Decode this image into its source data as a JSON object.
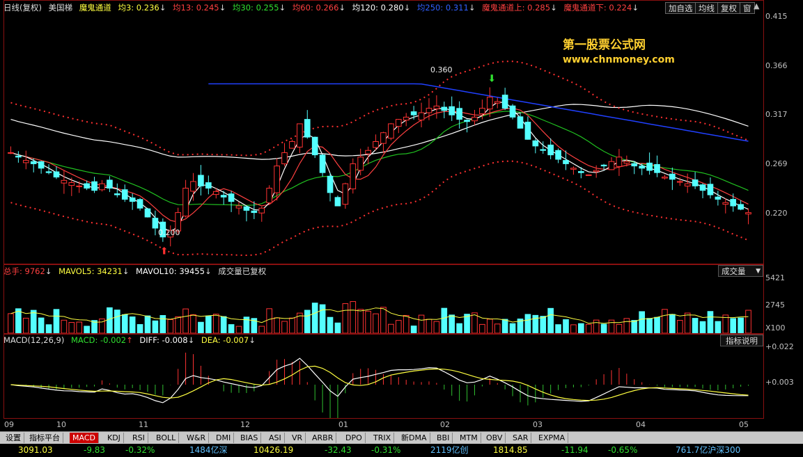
{
  "header": {
    "period": "日线(复权)",
    "stock": "美国梯",
    "indicator": "魔鬼通道",
    "ma3": "均3: 0.236",
    "ma13": "均13: 0.245",
    "ma30": "均30: 0.255",
    "ma60": "均60: 0.266",
    "ma120": "均120: 0.280",
    "ma250": "均250: 0.311",
    "upper": "魔鬼通道上: 0.285",
    "lower": "魔鬼通道下: 0.224",
    "buttons": [
      "加自选",
      "均线",
      "复权",
      "窗"
    ]
  },
  "watermark": {
    "title": "第一股票公式网",
    "url": "www.chnmoney.com"
  },
  "price_axis": [
    "0.415",
    "0.366",
    "0.317",
    "0.269",
    "0.220"
  ],
  "annotations": {
    "high": "0.360",
    "low": "0.200"
  },
  "volume_header": {
    "label": "总手: 9762",
    "mavol5": "MAVOL5: 34231",
    "mavol10": "MAVOL10: 39455",
    "note": "成交量已复权",
    "select": "成交量"
  },
  "volume_axis": [
    "5421",
    "2745",
    "X100"
  ],
  "macd_header": {
    "label": "MACD(12,26,9)",
    "macd": "MACD: -0.002",
    "diff": "DIFF: -0.008",
    "dea": "DEA: -0.007",
    "button": "指标说明"
  },
  "macd_axis": [
    "+0.022",
    "+0.003"
  ],
  "x_axis": [
    "09",
    "10",
    "11",
    "12",
    "01",
    "02",
    "03",
    "04",
    "05"
  ],
  "tabs": [
    "设置",
    "指标平台",
    "MACD",
    "KDJ",
    "RSI",
    "BOLL",
    "W&R",
    "DMI",
    "BIAS",
    "ASI",
    "VR",
    "ARBR",
    "DPO",
    "TRIX",
    "新DMA",
    "BBI",
    "MTM",
    "OBV",
    "SAR",
    "EXPMA"
  ],
  "status": {
    "sh_index": "3091.03",
    "sh_change": "-9.83",
    "sh_pct": "-0.32%",
    "sh_amount": "1484亿深",
    "sz_index": "10426.19",
    "sz_change": "-32.43",
    "sz_pct": "-0.31%",
    "cy_amount": "2119亿创",
    "cy_index": "1814.85",
    "cy_change": "-11.94",
    "cy_pct": "-0.65%",
    "hs_amount": "761.7亿沪深300"
  },
  "colors": {
    "up": "#ff3232",
    "down": "#54ffff",
    "ma3": "#ffffff",
    "ma13": "#ff4040",
    "ma30": "#20c020",
    "ma120": "#ffffff",
    "ma250": "#2040ff",
    "channel": "#ff3030",
    "accent": "#ffff00"
  },
  "chart_data": {
    "type": "candlestick",
    "title": "",
    "x_month_labels": [
      "09",
      "10",
      "11",
      "12",
      "01",
      "02",
      "03",
      "04",
      "05"
    ],
    "ylim": [
      0.19,
      0.415
    ],
    "price_ticks": [
      0.415,
      0.366,
      0.317,
      0.269,
      0.22
    ],
    "high": 0.36,
    "low": 0.2,
    "closes": [
      0.29,
      0.286,
      0.283,
      0.28,
      0.276,
      0.272,
      0.268,
      0.265,
      0.263,
      0.26,
      0.258,
      0.256,
      0.262,
      0.258,
      0.252,
      0.248,
      0.246,
      0.24,
      0.232,
      0.222,
      0.214,
      0.22,
      0.236,
      0.258,
      0.264,
      0.26,
      0.258,
      0.255,
      0.25,
      0.246,
      0.242,
      0.238,
      0.236,
      0.24,
      0.258,
      0.278,
      0.29,
      0.3,
      0.316,
      0.304,
      0.288,
      0.272,
      0.254,
      0.242,
      0.262,
      0.28,
      0.286,
      0.292,
      0.3,
      0.308,
      0.316,
      0.32,
      0.322,
      0.324,
      0.326,
      0.33,
      0.332,
      0.328,
      0.324,
      0.32,
      0.318,
      0.322,
      0.33,
      0.34,
      0.336,
      0.33,
      0.322,
      0.312,
      0.302,
      0.296,
      0.292,
      0.288,
      0.284,
      0.28,
      0.276,
      0.272,
      0.27,
      0.274,
      0.278,
      0.282,
      0.286,
      0.282,
      0.278,
      0.276,
      0.274,
      0.272,
      0.268,
      0.266,
      0.264,
      0.262,
      0.26,
      0.256,
      0.252,
      0.248,
      0.245,
      0.242,
      0.239,
      0.236
    ],
    "volume_ticks": [
      5421,
      2745
    ],
    "volume_unit": "X100",
    "macd_ticks": [
      0.022,
      0.003
    ],
    "macd": -0.002,
    "diff": -0.008,
    "dea": -0.007
  }
}
